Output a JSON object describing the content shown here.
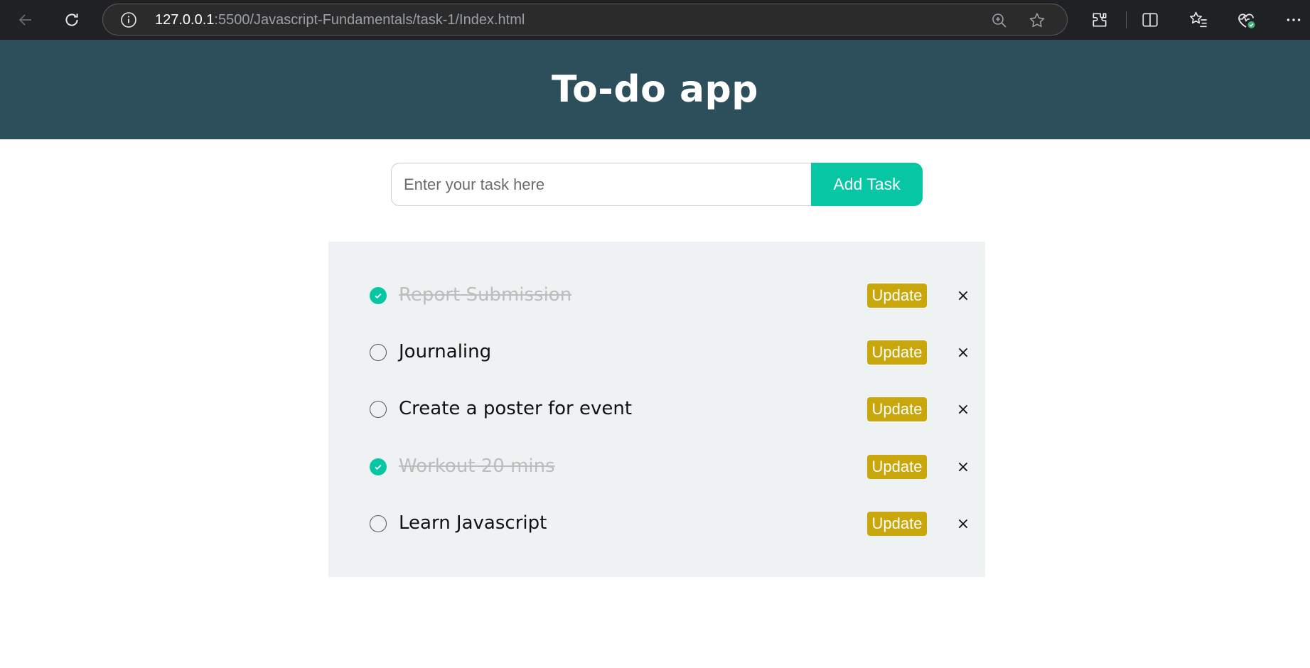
{
  "browser": {
    "url_host": "127.0.0.1",
    "url_path": ":5500/Javascript-Fundamentals/task-1/Index.html",
    "icons": [
      "back-icon",
      "refresh-icon",
      "site-info-icon",
      "zoom-icon",
      "favorite-star-icon",
      "extensions-icon",
      "split-screen-icon",
      "favorites-icon",
      "browser-essentials-icon",
      "more-icon"
    ]
  },
  "header": {
    "title": "To-do app"
  },
  "input": {
    "placeholder": "Enter your task here",
    "value": "",
    "add_label": "Add Task"
  },
  "tasks": [
    {
      "text": "Report Submission",
      "completed": true,
      "update_label": "Update",
      "delete_label": "×"
    },
    {
      "text": "Journaling",
      "completed": false,
      "update_label": "Update",
      "delete_label": "×"
    },
    {
      "text": "Create a poster for event",
      "completed": false,
      "update_label": "Update",
      "delete_label": "×"
    },
    {
      "text": "Workout 20 mins",
      "completed": true,
      "update_label": "Update",
      "delete_label": "×"
    },
    {
      "text": "Learn Javascript",
      "completed": false,
      "update_label": "Update",
      "delete_label": "×"
    }
  ],
  "colors": {
    "header_bg": "#2c4f5b",
    "accent": "#07c6a3",
    "update_bg": "#c9a60a",
    "panel_bg": "#eef2f3"
  }
}
